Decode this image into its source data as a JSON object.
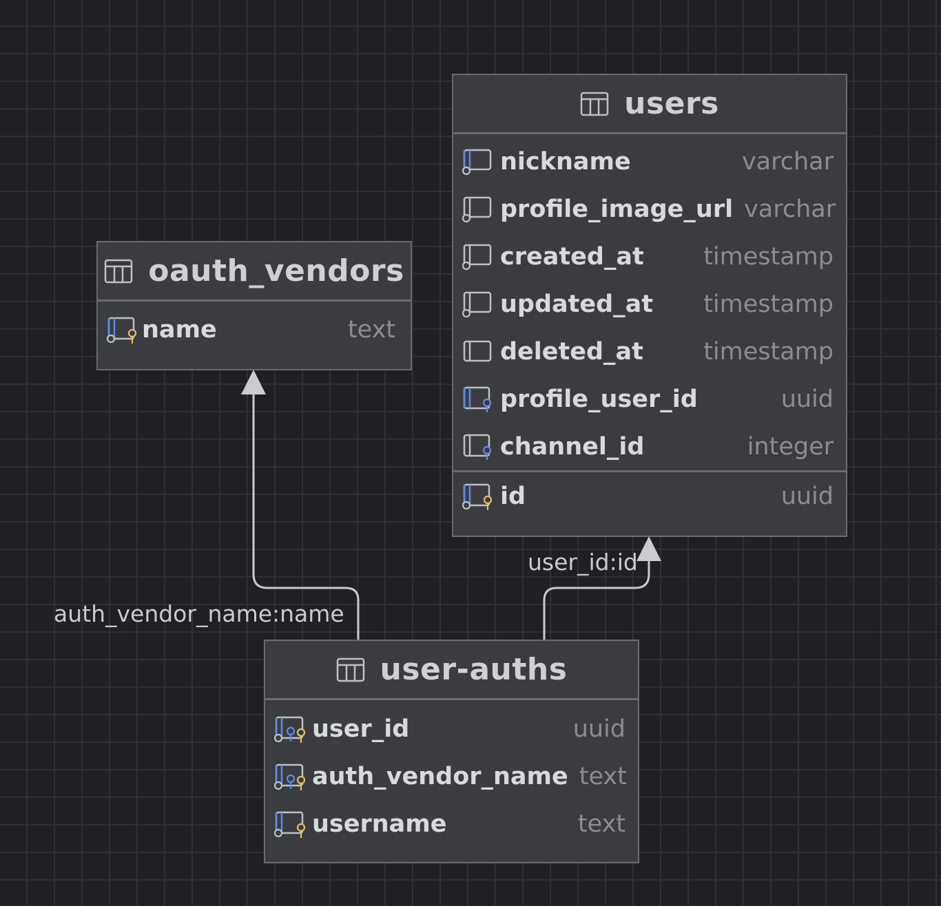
{
  "tables": {
    "users": {
      "title": "users",
      "columns": [
        {
          "name": "nickname",
          "type": "varchar",
          "icon": "column-nullable-icon"
        },
        {
          "name": "profile_image_url",
          "type": "varchar",
          "icon": "column-nullable-icon"
        },
        {
          "name": "created_at",
          "type": "timestamp",
          "icon": "column-nullable-icon"
        },
        {
          "name": "updated_at",
          "type": "timestamp",
          "icon": "column-nullable-icon"
        },
        {
          "name": "deleted_at",
          "type": "timestamp",
          "icon": "column-icon"
        },
        {
          "name": "profile_user_id",
          "type": "uuid",
          "icon": "column-unique-icon"
        },
        {
          "name": "channel_id",
          "type": "integer",
          "icon": "column-unique-icon"
        }
      ],
      "pk": {
        "name": "id",
        "type": "uuid",
        "icon": "primary-key-icon"
      }
    },
    "oauth_vendors": {
      "title": "oauth_vendors",
      "pk": {
        "name": "name",
        "type": "text",
        "icon": "primary-key-icon"
      }
    },
    "user_auths": {
      "title": "user-auths",
      "columns": [
        {
          "name": "user_id",
          "type": "uuid",
          "icon": "primary-foreign-key-icon"
        },
        {
          "name": "auth_vendor_name",
          "type": "text",
          "icon": "primary-foreign-key-icon"
        },
        {
          "name": "username",
          "type": "text",
          "icon": "primary-key-icon"
        }
      ]
    }
  },
  "relations": [
    {
      "label": "auth_vendor_name:name",
      "from": "user-auths",
      "to": "oauth_vendors"
    },
    {
      "label": "user_id:id",
      "from": "user-auths",
      "to": "users"
    }
  ],
  "colors": {
    "background": "#1f2023",
    "grid": "#2f3033",
    "table_bg": "#3b3c3f",
    "border": "#6a6b6e",
    "blue": "#5b8ce8",
    "key_yellow": "#e8c060",
    "edge": "#c9cbd0"
  }
}
